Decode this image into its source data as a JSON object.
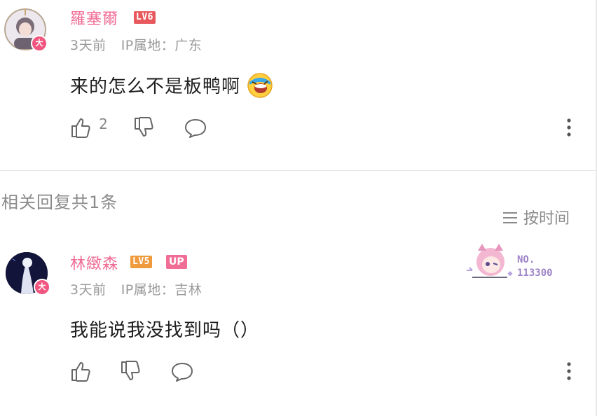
{
  "comment": {
    "username": "羅塞爾",
    "level": "LV6",
    "avatar_badge": "大",
    "time": "3天前",
    "ip_location": "IP属地：广东",
    "text": "来的怎么不是板鸭啊",
    "like_count": "2"
  },
  "replies_header": {
    "title": "相关回复共1条",
    "sort_label": "按时间"
  },
  "reply": {
    "username": "林緻森",
    "level": "LV5",
    "up_badge": "UP",
    "avatar_badge": "大",
    "time": "3天前",
    "ip_location": "IP属地：吉林",
    "text": "我能说我没找到吗（）",
    "card_no_label": "NO.",
    "card_no_value": "113300"
  },
  "colors": {
    "username": "#f06d96",
    "level6": "#e8595e",
    "level5": "#f09a3e",
    "up_badge": "#f06d96",
    "meta_text": "#9a9a9a"
  }
}
